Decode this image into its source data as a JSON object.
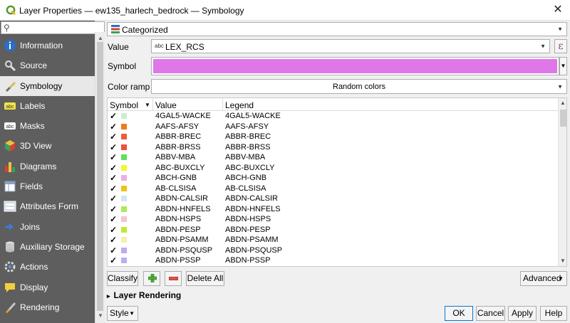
{
  "window": {
    "title": "Layer Properties — ew135_harlech_bedrock — Symbology",
    "close_glyph": "✕"
  },
  "search": {
    "placeholder": "",
    "icon": "search-icon"
  },
  "sidebar": {
    "items": [
      {
        "label": "Information",
        "icon": "info-icon",
        "color": "#2a6fc9"
      },
      {
        "label": "Source",
        "icon": "source-icon",
        "color": "#d9d9d9"
      },
      {
        "label": "Symbology",
        "icon": "paintbrush-icon",
        "color": "#e8d27a",
        "active": true
      },
      {
        "label": "Labels",
        "icon": "labels-icon",
        "color": "#f2e54a"
      },
      {
        "label": "Masks",
        "icon": "masks-icon",
        "color": "#ffffff"
      },
      {
        "label": "3D View",
        "icon": "cube-icon",
        "color": "#e0b040"
      },
      {
        "label": "Diagrams",
        "icon": "diagrams-icon",
        "color": "#3aa05a"
      },
      {
        "label": "Fields",
        "icon": "fields-icon",
        "color": "#cfd9e8"
      },
      {
        "label": "Attributes Form",
        "icon": "form-icon",
        "color": "#d0d8e6"
      },
      {
        "label": "Joins",
        "icon": "joins-icon",
        "color": "#3b7bd6"
      },
      {
        "label": "Auxiliary Storage",
        "icon": "storage-icon",
        "color": "#c8c8c8"
      },
      {
        "label": "Actions",
        "icon": "actions-icon",
        "color": "#5a8fd0"
      },
      {
        "label": "Display",
        "icon": "display-icon",
        "color": "#f0d040"
      },
      {
        "label": "Rendering",
        "icon": "rendering-icon",
        "color": "#f0a030"
      }
    ]
  },
  "renderer": {
    "value": "Categorized",
    "icon": "categorized-icon"
  },
  "value_field": {
    "label": "Value",
    "type_tag": "abc",
    "value": "LEX_RCS",
    "expr_glyph": "ε"
  },
  "symbol": {
    "label": "Symbol",
    "color": "#df77e8"
  },
  "color_ramp": {
    "label": "Color ramp",
    "value": "Random colors"
  },
  "table": {
    "headers": {
      "symbol": "Symbol",
      "value": "Value",
      "legend": "Legend"
    },
    "check_glyph": "✓",
    "rows": [
      {
        "value": "4GAL5-WACKE",
        "legend": "4GAL5-WACKE",
        "color": "#cdeccd"
      },
      {
        "value": "AAFS-AFSY",
        "legend": "AAFS-AFSY",
        "color": "#f07a1a"
      },
      {
        "value": "ABBR-BREC",
        "legend": "ABBR-BREC",
        "color": "#ee5a3a"
      },
      {
        "value": "ABBR-BRSS",
        "legend": "ABBR-BRSS",
        "color": "#ef4f3f"
      },
      {
        "value": "ABBV-MBA",
        "legend": "ABBV-MBA",
        "color": "#5de05d"
      },
      {
        "value": "ABC-BUXCLY",
        "legend": "ABC-BUXCLY",
        "color": "#f5f52a"
      },
      {
        "value": "ABCH-GNB",
        "legend": "ABCH-GNB",
        "color": "#e9aee9"
      },
      {
        "value": "AB-CLSISA",
        "legend": "AB-CLSISA",
        "color": "#eec21a"
      },
      {
        "value": "ABDN-CALSIR",
        "legend": "ABDN-CALSIR",
        "color": "#cfe6f7"
      },
      {
        "value": "ABDN-HNFELS",
        "legend": "ABDN-HNFELS",
        "color": "#ade85a"
      },
      {
        "value": "ABDN-HSPS",
        "legend": "ABDN-HSPS",
        "color": "#f7c3cf"
      },
      {
        "value": "ABDN-PESP",
        "legend": "ABDN-PESP",
        "color": "#c4e82e"
      },
      {
        "value": "ABDN-PSAMM",
        "legend": "ABDN-PSAMM",
        "color": "#f6efae"
      },
      {
        "value": "ABDN-PSQUSP",
        "legend": "ABDN-PSQUSP",
        "color": "#c3a8ef"
      },
      {
        "value": "ABDN-PSSP",
        "legend": "ABDN-PSSP",
        "color": "#b8b0f2"
      }
    ]
  },
  "buttons": {
    "classify": "Classify",
    "add_icon": "add-icon",
    "remove_icon": "remove-icon",
    "delete_all": "Delete All",
    "advanced": "Advanced",
    "style": "Style",
    "ok": "OK",
    "cancel": "Cancel",
    "apply": "Apply",
    "help": "Help"
  },
  "layer_rendering": {
    "label": "Layer Rendering",
    "glyph": "▸"
  },
  "colors": {
    "accent": "#0078d7",
    "sidebar_bg": "#5e5e5e",
    "check": "#000000"
  }
}
